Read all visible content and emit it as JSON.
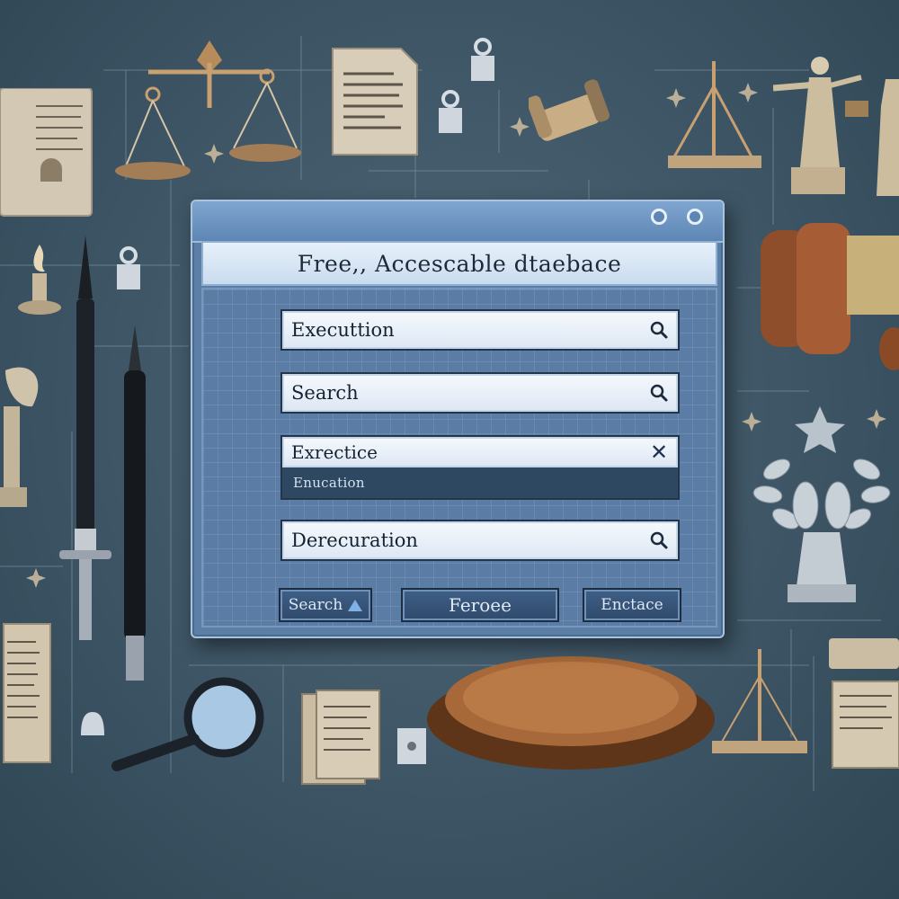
{
  "window": {
    "heading": "Free,, Accescable dtaebace"
  },
  "fields": [
    {
      "value": "Executtion",
      "icon": "search-icon"
    },
    {
      "value": "Search",
      "icon": "search-icon"
    },
    {
      "value": "Derecuration",
      "icon": "search-icon"
    }
  ],
  "combo": {
    "value": "Exrectice",
    "close_icon": "close-icon",
    "option": "Enucation"
  },
  "buttons": {
    "search": "Search",
    "primary": "Feroee",
    "third": "Enctace"
  },
  "colors": {
    "background": "#3d5565",
    "window": "#5d7fa6",
    "field": "#eef4fb",
    "button": "#35547a",
    "dropdown_option": "#2f4862"
  }
}
